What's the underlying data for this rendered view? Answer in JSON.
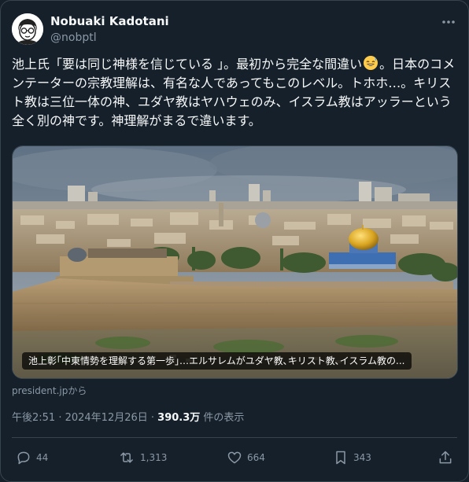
{
  "author": {
    "name": "Nobuaki Kadotani",
    "handle": "@nobptl",
    "avatar": "face-illustration-icon"
  },
  "tweet": {
    "text_part1": "池上氏「要は同じ神様を信じている 」。最初から完全な間違い",
    "emoji": "grinning-sweat-emoji",
    "text_part2": "。日本のコメンテーターの宗教理解は、有名な人であってもこのレベル。トホホ…。キリスト教は三位一体の神、ユダヤ教はヤハウェのみ、イスラム教はアッラーという全く別の神です。神理解がまるで違います。"
  },
  "link_card": {
    "caption": "池上彰｢中東情勢を理解する第一歩｣…エルサレムがユダヤ教､キリスト教､イスラム教の...",
    "source": "president.jpから",
    "image": "jerusalem-old-city-photo"
  },
  "meta": {
    "time_date": "午後2:51 · 2024年12月26日 · ",
    "views": "390.3万",
    "views_label": " 件の表示"
  },
  "actions": {
    "replies": "44",
    "reposts": "1,313",
    "likes": "664",
    "bookmarks": "343"
  },
  "colors": {
    "background": "#15202b",
    "text": "#f7f9f9",
    "secondary": "#8b98a5",
    "border": "#38444d",
    "dome_gold": "#d9a521"
  }
}
